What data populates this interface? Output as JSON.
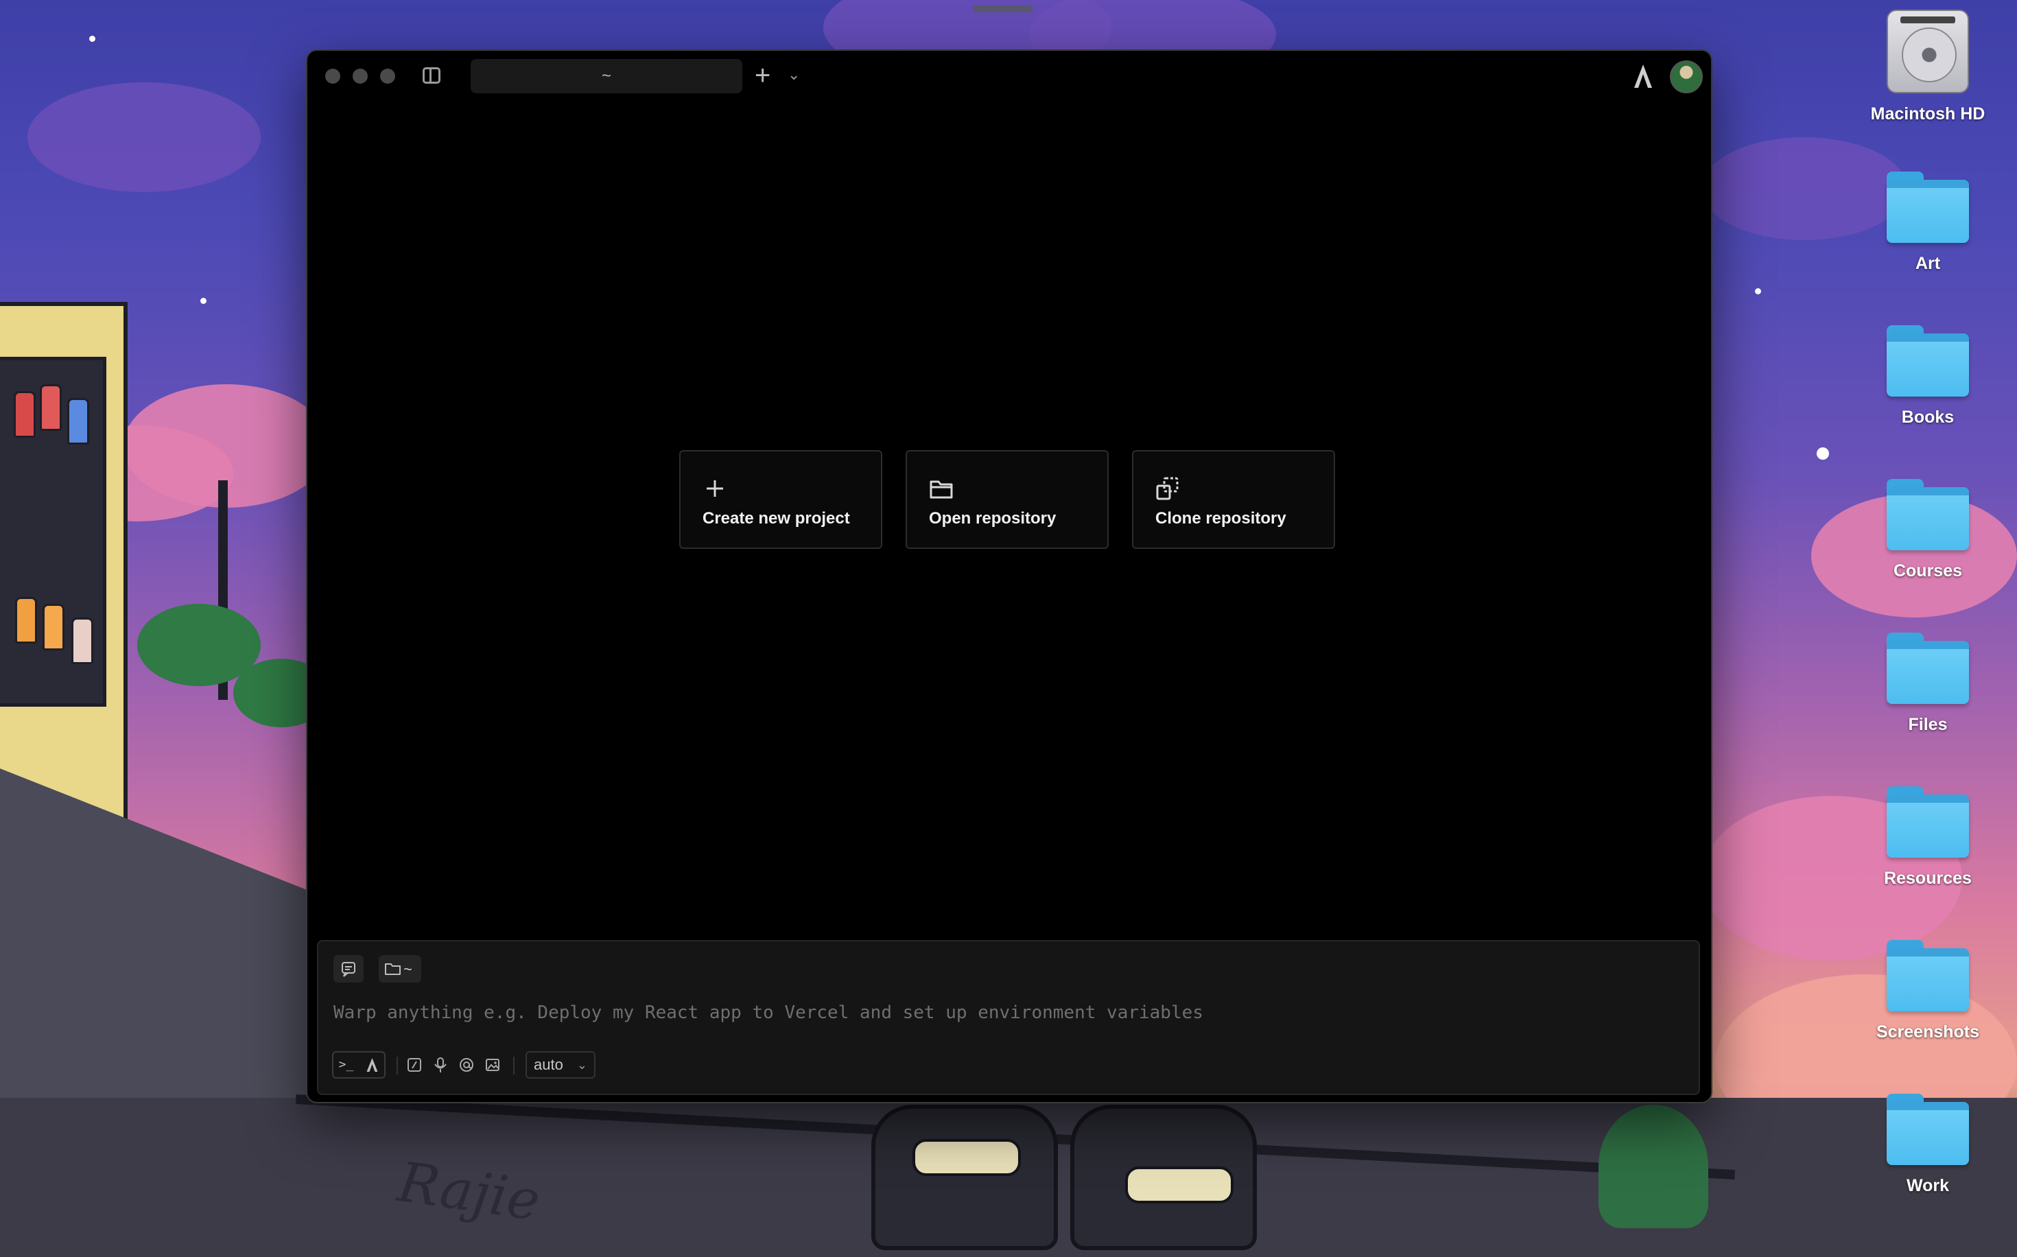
{
  "desktop": {
    "icons": [
      {
        "label": "Macintosh HD",
        "kind": "drive-icon"
      },
      {
        "label": "Art",
        "kind": "folder-icon"
      },
      {
        "label": "Books",
        "kind": "folder-icon"
      },
      {
        "label": "Courses",
        "kind": "folder-icon"
      },
      {
        "label": "Files",
        "kind": "folder-icon"
      },
      {
        "label": "Resources",
        "kind": "folder-icon"
      },
      {
        "label": "Screenshots",
        "kind": "folder-icon"
      },
      {
        "label": "Work",
        "kind": "folder-icon"
      }
    ],
    "wallpaper_signature": "Rajie"
  },
  "window": {
    "tab_title": "~",
    "new_tab_label": "+",
    "new_tab_menu_label": "⌄"
  },
  "actions": {
    "create": {
      "label": "Create new project",
      "icon": "plus-icon"
    },
    "open": {
      "label": "Open repository",
      "icon": "folder-icon"
    },
    "clone": {
      "label": "Clone repository",
      "icon": "clone-icon"
    }
  },
  "input": {
    "directory_label": "~",
    "placeholder": "Warp anything e.g. Deploy my React app to Vercel and set up environment variables",
    "value": "",
    "terminal_mode_label": ">_",
    "model_label": "auto"
  },
  "colors": {
    "window_bg": "#000000",
    "panel_bg": "#151515",
    "folder_blue": "#4dbdf0"
  }
}
